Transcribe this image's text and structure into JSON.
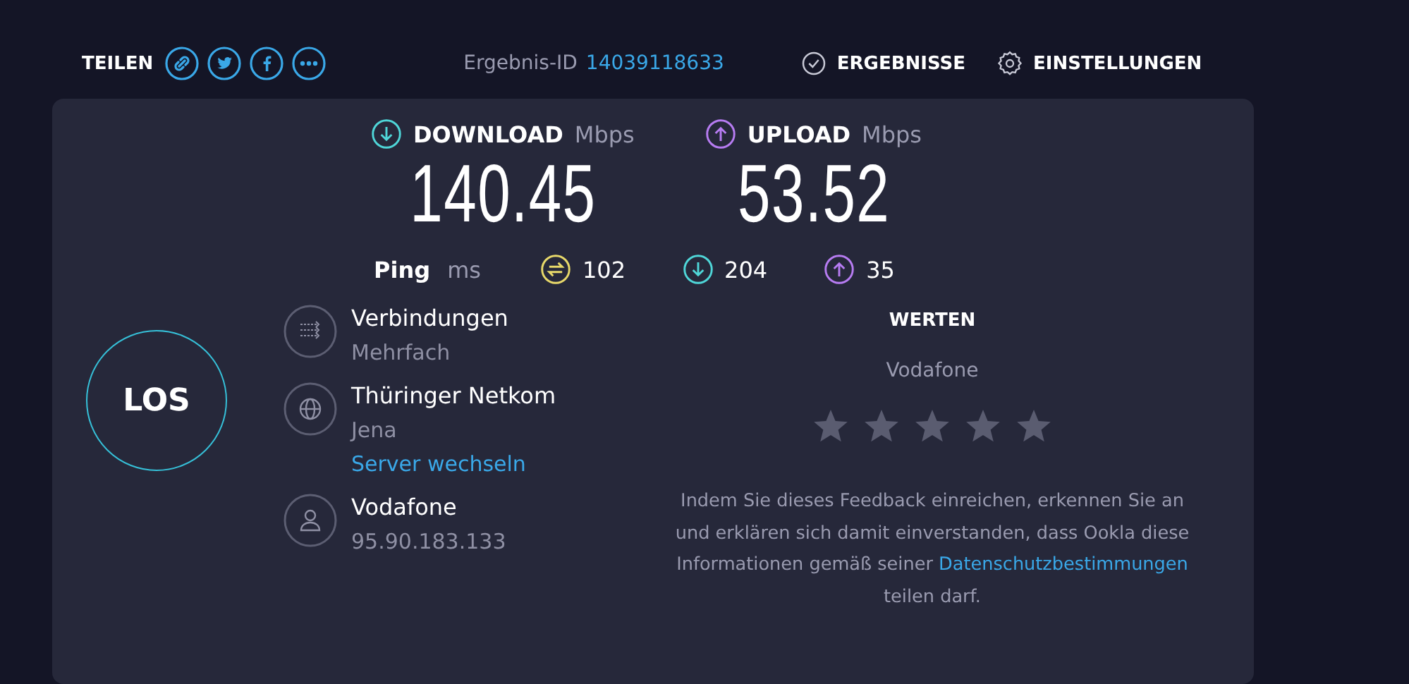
{
  "header": {
    "share_label": "TEILEN",
    "share_icons": [
      {
        "kind": "link"
      },
      {
        "kind": "twitter"
      },
      {
        "kind": "facebook"
      },
      {
        "kind": "more"
      }
    ],
    "result_label": "Ergebnis-ID",
    "result_id": "14039118633",
    "nav": [
      {
        "kind": "results",
        "label": "ERGEBNISSE"
      },
      {
        "kind": "settings",
        "label": "EINSTELLUNGEN"
      }
    ]
  },
  "speeds": [
    {
      "kind": "download",
      "label": "DOWNLOAD",
      "unit": "Mbps",
      "value": "140.45"
    },
    {
      "kind": "upload",
      "label": "UPLOAD",
      "unit": "Mbps",
      "value": "53.52"
    }
  ],
  "ping": {
    "label": "Ping",
    "unit": "ms",
    "readings": [
      {
        "kind": "idle",
        "value": "102"
      },
      {
        "kind": "download",
        "value": "204"
      },
      {
        "kind": "upload",
        "value": "35"
      }
    ]
  },
  "go_button": "LOS",
  "connections": [
    {
      "kind": "connections",
      "title": "Verbindungen",
      "subtitle": "Mehrfach"
    },
    {
      "kind": "server",
      "title": "Thüringer Netkom",
      "subtitle": "Jena",
      "link": "Server wechseln"
    },
    {
      "kind": "provider",
      "title": "Vodafone",
      "subtitle": "95.90.183.133"
    }
  ],
  "rating": {
    "title": "WERTEN",
    "provider": "Vodafone",
    "stars": 0,
    "notice_before": "Indem Sie dieses Feedback einreichen, erkennen Sie an und erklären sich damit einverstanden, dass Ookla diese Informationen gemäß seiner",
    "notice_link": "Datenschutzbestimmungen",
    "notice_after": "teilen darf."
  }
}
